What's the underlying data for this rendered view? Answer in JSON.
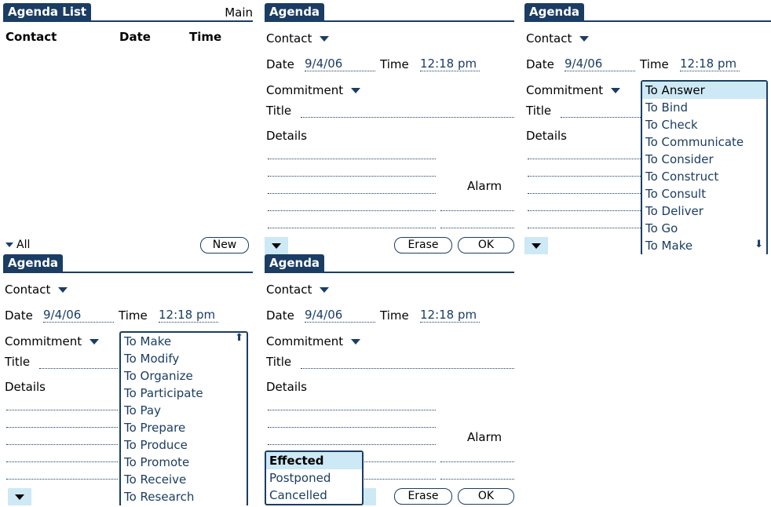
{
  "screens": {
    "list": {
      "tab": "Agenda List",
      "main": "Main",
      "headers": [
        "Contact",
        "Date",
        "Time"
      ],
      "filter": "All",
      "new_button": "New"
    },
    "form": {
      "tab": "Agenda",
      "contact": "Contact",
      "date_label": "Date",
      "date_value": "9/4/06",
      "time_label": "Time",
      "time_value": "12:18 pm",
      "commitment": "Commitment",
      "title_label": "Title",
      "details_label": "Details",
      "alarm_label": "Alarm",
      "erase_button": "Erase",
      "ok_button": "OK"
    },
    "commitment_list_a": [
      "To Answer",
      "To Bind",
      "To Check",
      "To Communicate",
      "To Consider",
      "To Construct",
      "To Consult",
      "To Deliver",
      "To Go",
      "To Make"
    ],
    "commitment_list_b": [
      "To Make",
      "To Modify",
      "To Organize",
      "To Participate",
      "To Pay",
      "To Prepare",
      "To Produce",
      "To Promote",
      "To Receive",
      "To Research"
    ],
    "status_list": [
      "Effected",
      "Postponed",
      "Cancelled"
    ]
  },
  "icons": [
    "dropdown-triangle-icon",
    "scroll-down-icon",
    "scroll-up-icon"
  ],
  "colors": {
    "accent": "#1b3d63",
    "selection": "#cde9f5"
  }
}
